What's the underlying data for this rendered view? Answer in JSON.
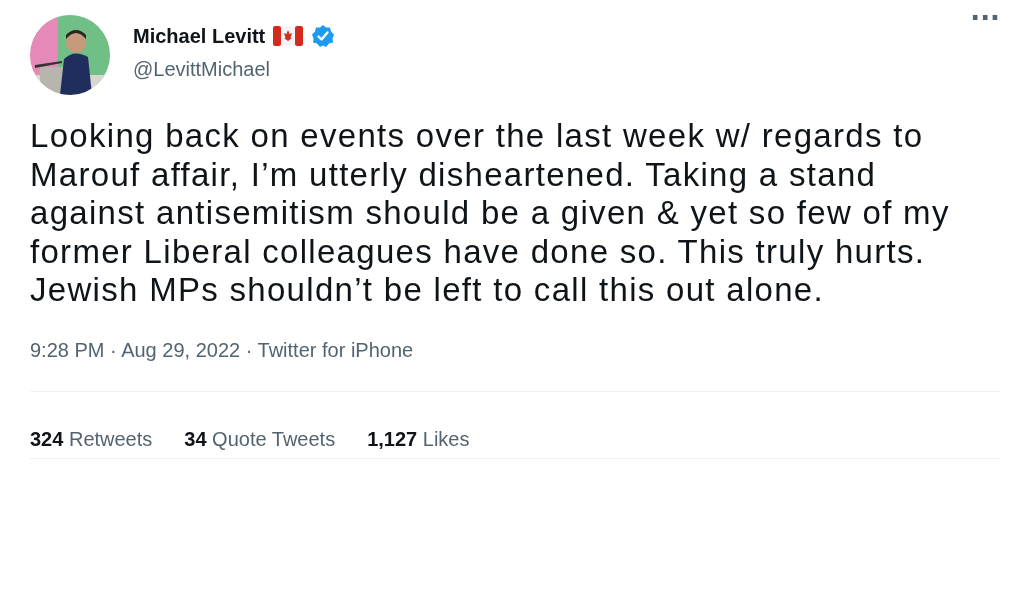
{
  "author": {
    "name": "Michael Levitt",
    "handle": "@LevittMichael",
    "verified": true
  },
  "menu": "···",
  "text": "Looking back on events over the last week w/ regards to Marouf affair, I’m utterly disheartened. Taking a stand against antisemitism should be a given & yet so few of my former Liberal colleagues have done so. This truly hurts. Jewish MPs shouldn’t be left to call this out alone.",
  "meta": "9:28 PM · Aug 29, 2022 · Twitter for iPhone",
  "stats": [
    {
      "count": "324",
      "label": "Retweets"
    },
    {
      "count": "34",
      "label": "Quote Tweets"
    },
    {
      "count": "1,127",
      "label": "Likes"
    }
  ]
}
